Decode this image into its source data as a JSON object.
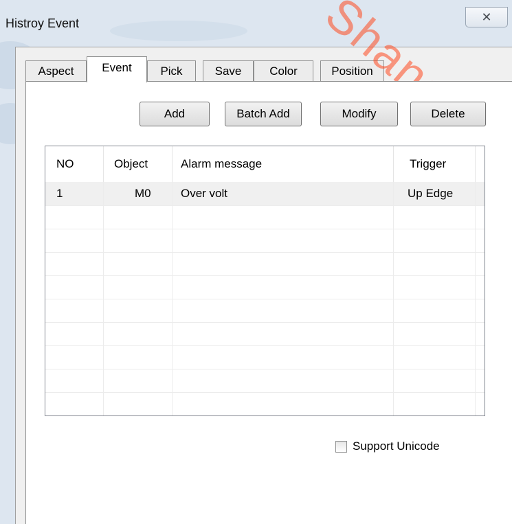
{
  "window": {
    "title": "Histroy Event",
    "close_glyph": "✕"
  },
  "watermark": "Shanghai Automatco",
  "tabs": [
    {
      "label": "Aspect",
      "active": false
    },
    {
      "label": "Event",
      "active": true
    },
    {
      "label": "Pick",
      "active": false
    },
    {
      "label": "Save",
      "active": false
    },
    {
      "label": "Color",
      "active": false
    },
    {
      "label": "Position",
      "active": false
    }
  ],
  "toolbar": {
    "add_label": "Add",
    "batch_add_label": "Batch Add",
    "modify_label": "Modify",
    "delete_label": "Delete"
  },
  "table": {
    "columns": [
      "NO",
      "Object",
      "Alarm message",
      "Trigger"
    ],
    "rows": [
      {
        "no": "1",
        "object": "M0",
        "message": "Over volt",
        "trigger": "Up Edge"
      }
    ]
  },
  "options": {
    "support_unicode_label": "Support Unicode",
    "support_unicode_checked": false
  },
  "colors": {
    "watermark": "#ff4a20",
    "dialog_frame": "#dde6f0",
    "panel_bg": "#ffffff"
  }
}
